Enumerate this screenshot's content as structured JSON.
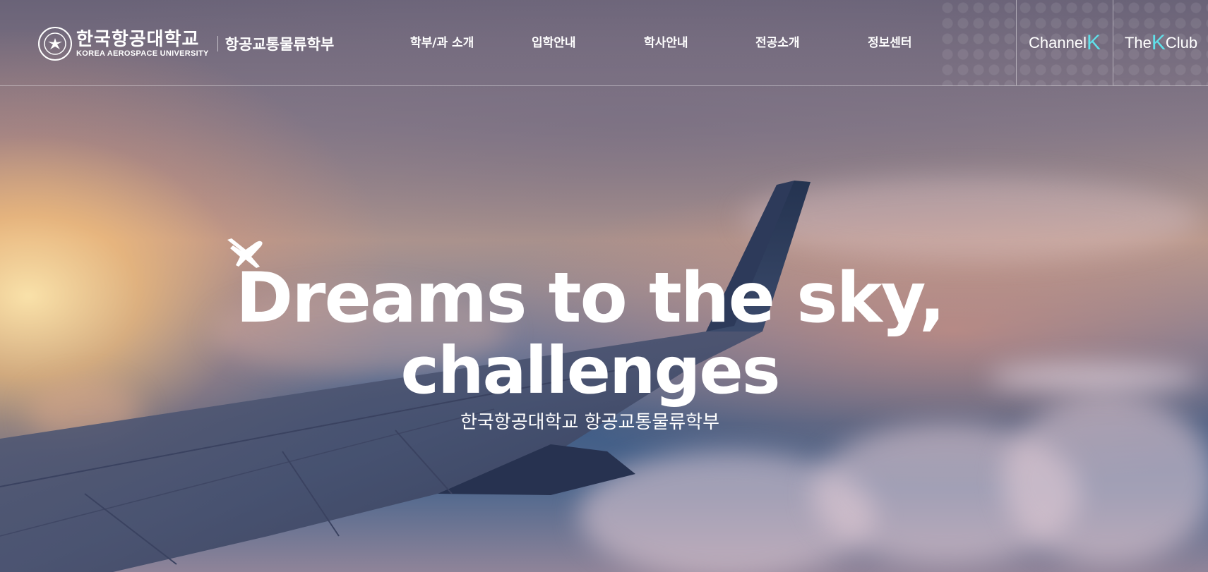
{
  "header": {
    "logo_korean": "한국항공대학교",
    "logo_english": "KOREA AEROSPACE UNIVERSITY",
    "department": "항공교통물류학부"
  },
  "nav": {
    "items": [
      {
        "label": "학부/과 소개"
      },
      {
        "label": "입학안내"
      },
      {
        "label": "학사안내"
      },
      {
        "label": "전공소개"
      },
      {
        "label": "정보센터"
      }
    ]
  },
  "side_links": {
    "channel_prefix": "Channel",
    "channel_suffix": "K",
    "club_prefix": "The",
    "club_middle": "K",
    "club_suffix": "Club"
  },
  "hero": {
    "headline_line1": "Dreams to the sky,",
    "headline_line2": "challenges",
    "subtitle": "한국항공대학교 항공교통물류학부"
  },
  "colors": {
    "accent": "#5fe1ea",
    "text": "#ffffff"
  },
  "icons": {
    "emblem": "university-emblem-icon",
    "plane": "airplane-icon"
  }
}
